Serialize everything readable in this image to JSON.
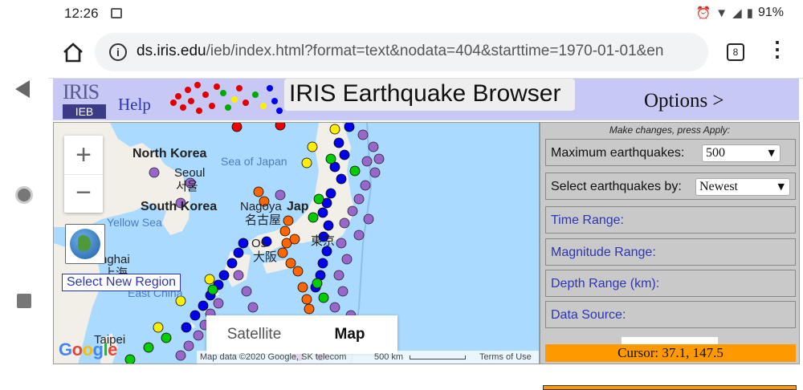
{
  "status_bar": {
    "time": "12:26",
    "battery": "91%",
    "icons": [
      "image-icon",
      "alarm-icon",
      "wifi-icon",
      "signal-icon",
      "battery-icon"
    ]
  },
  "browser": {
    "url_host": "ds.iris.edu",
    "url_path": "/ieb/index.html?format=text&nodata=404&starttime=1970-01-01&en",
    "tab_count": "8"
  },
  "header": {
    "logo_text": "IRIS",
    "logo_sub": "IEB",
    "help": "Help",
    "title": "IRIS Earthquake Browser",
    "options": "Options >"
  },
  "map": {
    "labels": {
      "north_korea": "North Korea",
      "sea_of_japan": "Sea of Japan",
      "seoul": "Seoul",
      "seoul_ko": "서울",
      "south_korea": "South Korea",
      "yellow_sea": "Yellow Sea",
      "nagoya": "Nagoya",
      "nagoya_jp": "名古屋",
      "japan_partial": "Jap",
      "osaka_partial": "Os",
      "osaka_jp": "大阪",
      "shanghai_partial": "nghai",
      "shanghai_cn": "上海",
      "east_china_sea_partial": "East China",
      "taipei": "Taipei",
      "tokyo_jp": "東京"
    },
    "zoom_in": "+",
    "zoom_out": "−",
    "select_region": "Select New Region",
    "map_types": [
      "Satellite",
      "Map"
    ],
    "active_map_type": "Map",
    "google": "Google",
    "attribution": "Map data ©2020 Google, SK telecom",
    "scale": "500 km",
    "terms": "Terms of Use",
    "colors": {
      "water": "#aadaff",
      "land": "#f2efe9",
      "shallow": "#ff0000",
      "mid": "#ff6600",
      "deep": "#ffff00",
      "deeper": "#00cc00",
      "deepest": "#0000ff",
      "very_deep": "#9966cc"
    }
  },
  "panel": {
    "hint": "Make changes, press Apply:",
    "max_quakes_label": "Maximum earthquakes:",
    "max_quakes_value": "500",
    "select_by_label": "Select earthquakes by:",
    "select_by_value": "Newest",
    "time_range": "Time Range:",
    "magnitude_range": "Magnitude Range:",
    "depth_range": "Depth Range (km):",
    "data_source": "Data Source:",
    "cursor": "Cursor: 37.1, 147.5"
  }
}
